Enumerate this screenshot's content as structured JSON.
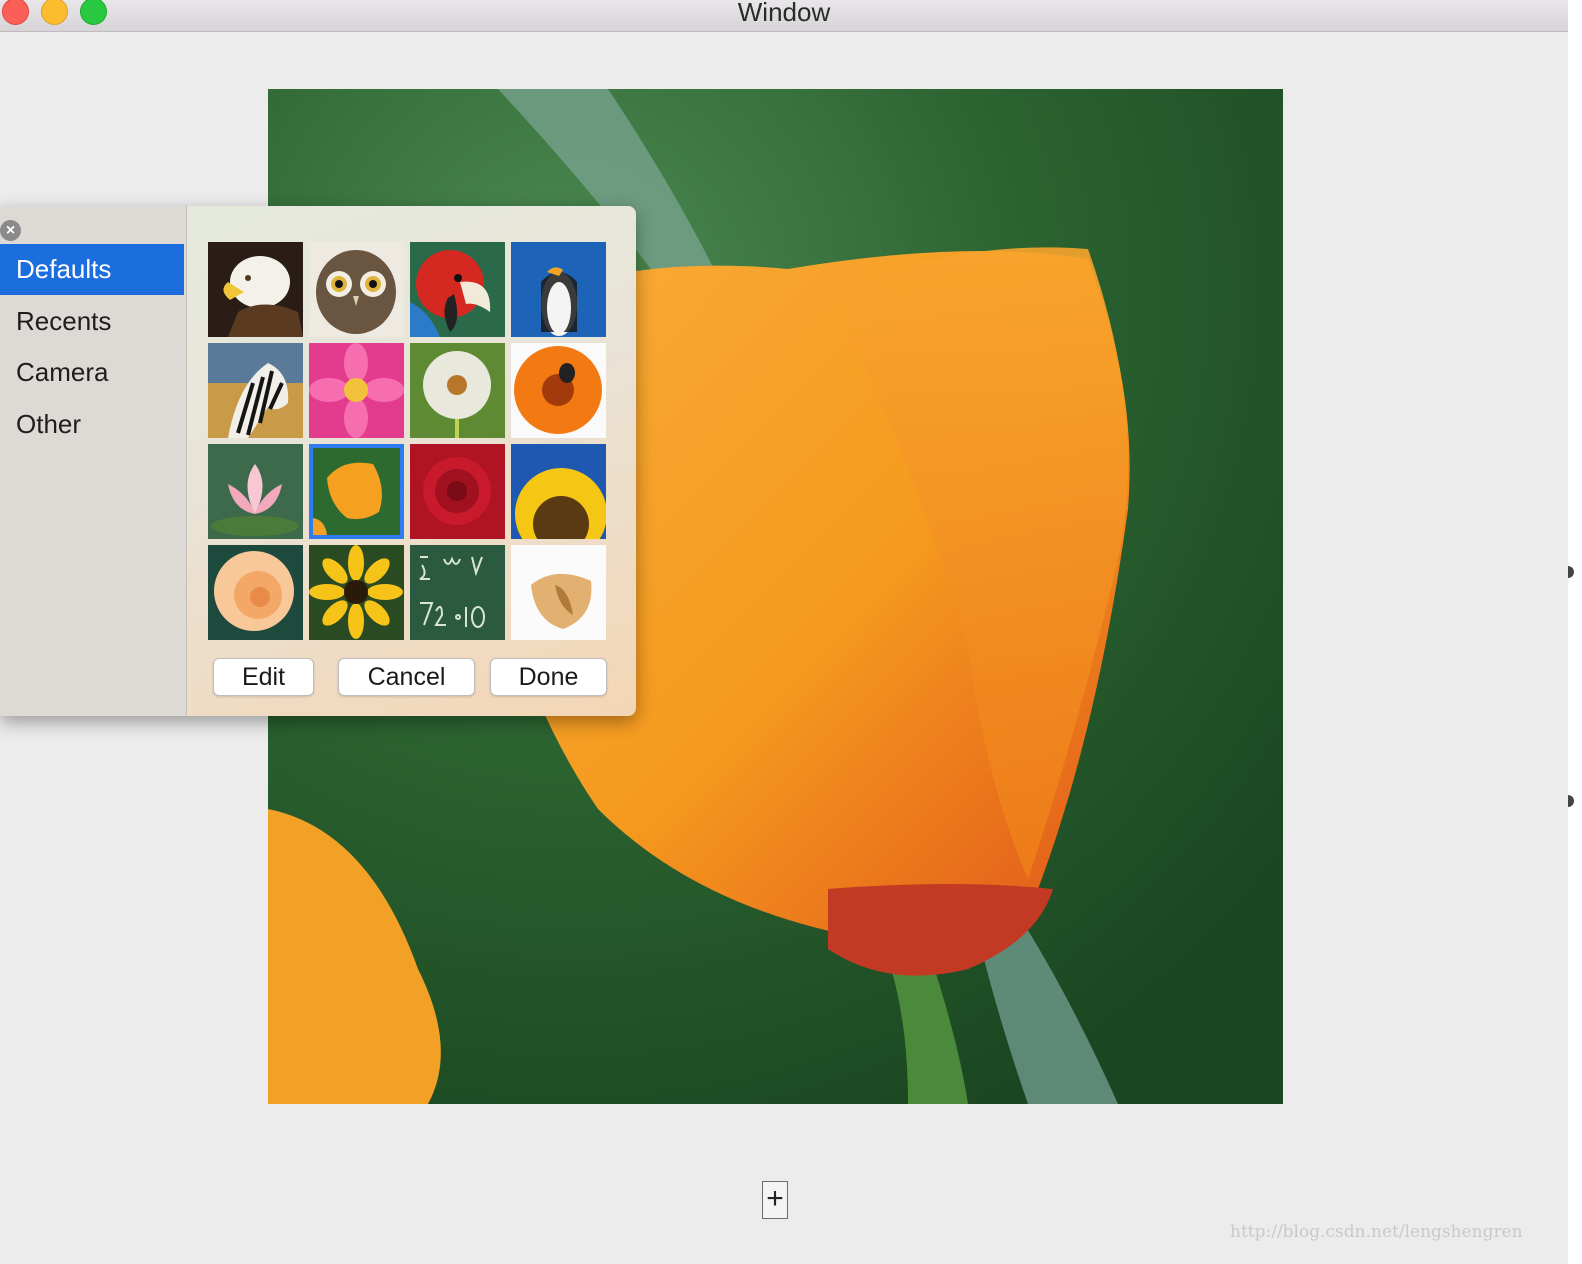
{
  "window": {
    "title": "Window"
  },
  "popover": {
    "sidebar": [
      {
        "label": "Defaults",
        "selected": true
      },
      {
        "label": "Recents",
        "selected": false
      },
      {
        "label": "Camera",
        "selected": false
      },
      {
        "label": "Other",
        "selected": false
      }
    ],
    "images": [
      {
        "name": "eagle",
        "selected": false
      },
      {
        "name": "owl",
        "selected": false
      },
      {
        "name": "parrot",
        "selected": false
      },
      {
        "name": "penguin",
        "selected": false
      },
      {
        "name": "zebra",
        "selected": false
      },
      {
        "name": "pink-dahlia",
        "selected": false
      },
      {
        "name": "dandelion",
        "selected": false
      },
      {
        "name": "orange-gerbera",
        "selected": false
      },
      {
        "name": "lotus",
        "selected": false
      },
      {
        "name": "poppy",
        "selected": true
      },
      {
        "name": "red-rose",
        "selected": false
      },
      {
        "name": "sunflower",
        "selected": false
      },
      {
        "name": "peach-rose",
        "selected": false
      },
      {
        "name": "black-eyed-susan",
        "selected": false
      },
      {
        "name": "chalkboard",
        "selected": false
      },
      {
        "name": "fortune-cookie",
        "selected": false
      }
    ],
    "buttons": {
      "edit": "Edit",
      "cancel": "Cancel",
      "done": "Done"
    }
  },
  "add_button": {
    "label": "+"
  },
  "watermark": "http://blog.csdn.net/lengshengren",
  "colors": {
    "selection_blue": "#1c6ede",
    "tile_highlight": "#2f7cf0",
    "poppy_orange": "#f5a024"
  }
}
